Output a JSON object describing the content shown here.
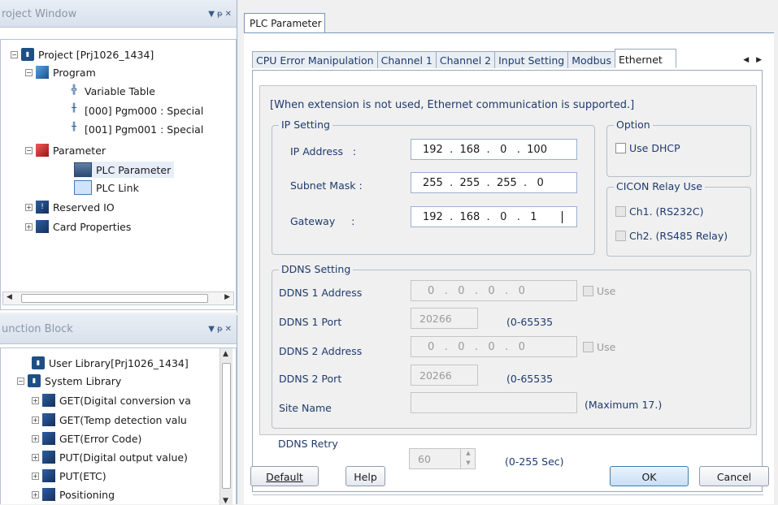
{
  "project_window": {
    "title": "roject Window",
    "ctrls": [
      "▼",
      "ᵽ",
      "✕"
    ],
    "tree": {
      "project": "Project [Prj1026_1434]",
      "program": "Program",
      "variable_table": "Variable Table",
      "pgm0": "[000] Pgm000 : Special",
      "pgm1": "[001] Pgm001 : Special",
      "parameter": "Parameter",
      "plc_parameter": "PLC Parameter",
      "plc_link": "PLC Link",
      "reserved_io": "Reserved IO",
      "card_properties": "Card Properties"
    }
  },
  "function_block": {
    "title": "unction Block",
    "ctrls": [
      "▼",
      "ᵽ",
      "✕"
    ],
    "items": [
      "User Library[Prj1026_1434]",
      "System Library",
      "GET(Digital conversion va",
      "GET(Temp detection valu",
      "GET(Error Code)",
      "PUT(Digital output value)",
      "PUT(ETC)",
      "Positioning"
    ]
  },
  "doc_tab": "PLC Parameter",
  "dialog": {
    "tabs": [
      "CPU Error Manipulation",
      "Channel 1",
      "Channel 2",
      "Input Setting",
      "Modbus",
      "Ethernet"
    ],
    "active_tab": "Ethernet",
    "tab_arrows": "◀ ▶",
    "note": "[When extension is not used, Ethernet communication is supported.]",
    "ip_setting": {
      "title": "IP Setting",
      "ip_label": "IP Address   :",
      "ip_value": "192  .  168  .   0   .  100",
      "subnet_label": "Subnet Mask :",
      "subnet_value": "255  .  255  .  255  .   0",
      "gateway_label": "Gateway     :",
      "gateway_value": "192  .  168  .   0   .   1"
    },
    "option": {
      "title": "Option",
      "use_dhcp": "Use DHCP"
    },
    "cicon": {
      "title": "CICON Relay Use",
      "ch1": "Ch1. (RS232C)",
      "ch2": "Ch2. (RS485 Relay)"
    },
    "ddns": {
      "title": "DDNS Setting",
      "addr1_label": "DDNS 1 Address",
      "addr1_value": "0   .   0   .   0   .   0",
      "use1": "Use",
      "port1_label": "DDNS 1 Port",
      "port1_value": "20266",
      "port1_range": "(0-65535",
      "addr2_label": "DDNS 2 Address",
      "addr2_value": "0   .   0   .   0   .   0",
      "use2": "Use",
      "port2_label": "DDNS 2 Port",
      "port2_value": "20266",
      "port2_range": "(0-65535",
      "site_label": "Site Name",
      "site_value": "",
      "site_max": "(Maximum 17.)",
      "retry_label": "DDNS Retry",
      "retry_value": "60",
      "retry_range": "(0-255 Sec)"
    },
    "buttons": {
      "default": "Default",
      "help": "Help",
      "ok": "OK",
      "cancel": "Cancel"
    }
  }
}
